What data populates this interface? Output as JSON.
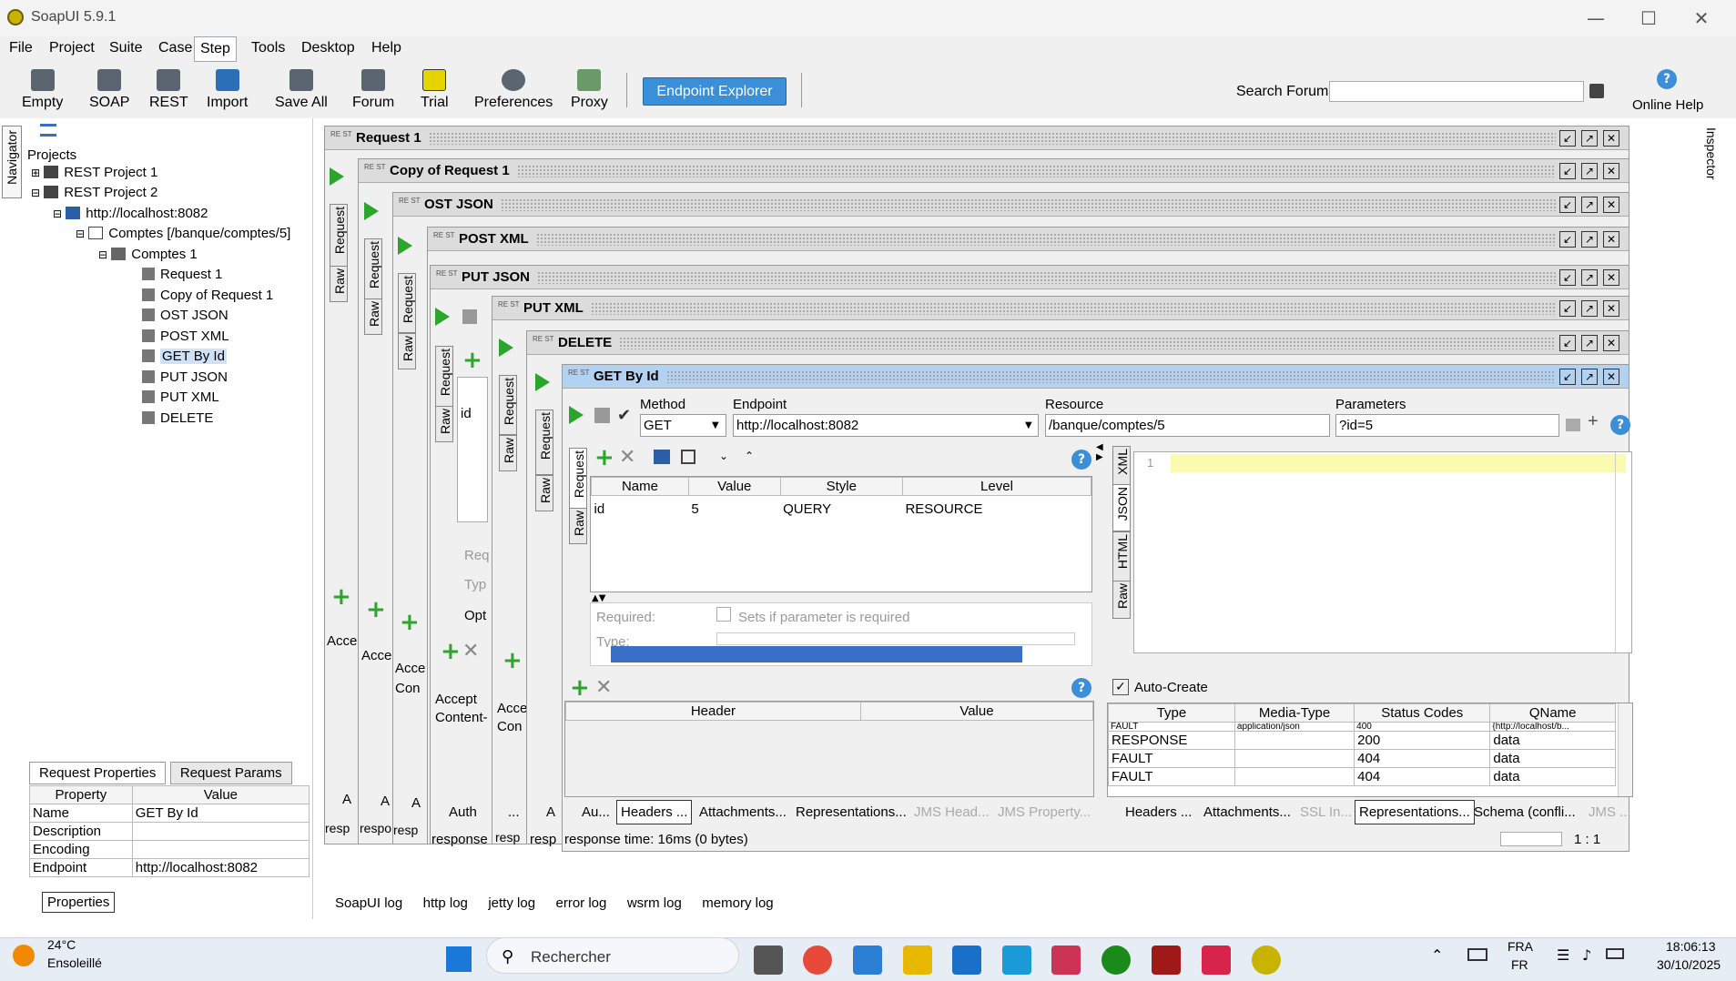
{
  "app": {
    "title": "SoapUI 5.9.1"
  },
  "menu": [
    "File",
    "Project",
    "Suite",
    "Case",
    "Step",
    "Tools",
    "Desktop",
    "Help"
  ],
  "toolbar": {
    "items": [
      "Empty",
      "SOAP",
      "REST",
      "Import",
      "Save All",
      "Forum",
      "Trial",
      "Preferences",
      "Proxy"
    ],
    "endpoint_explorer": "Endpoint Explorer",
    "search_label": "Search Forum",
    "online_help": "Online Help"
  },
  "navigator": {
    "tab": "Navigator",
    "root": "Projects",
    "tree": {
      "p1": "REST Project 1",
      "p2": "REST Project 2",
      "service": "http://localhost:8082",
      "resource": "Comptes [/banque/comptes/5]",
      "method": "Comptes 1",
      "requests": [
        "Request 1",
        "Copy of Request 1",
        "OST JSON",
        "POST XML",
        "GET By Id",
        "PUT JSON",
        "PUT XML",
        "DELETE"
      ]
    }
  },
  "props": {
    "tabs": [
      "Request Properties",
      "Request Params"
    ],
    "headers": [
      "Property",
      "Value"
    ],
    "rows": [
      [
        "Name",
        "GET By Id"
      ],
      [
        "Description",
        ""
      ],
      [
        "Encoding",
        ""
      ],
      [
        "Endpoint",
        "http://localhost:8082"
      ]
    ],
    "button": "Properties"
  },
  "inspector": "Inspector",
  "windows": [
    "Request 1",
    "Copy of Request 1",
    "OST JSON",
    "POST XML",
    "PUT JSON",
    "PUT XML",
    "DELETE",
    "GET By Id"
  ],
  "bg": {
    "request": "Request",
    "raw": "Raw",
    "acc": "Acce",
    "accept": "Accept",
    "content": "Content-",
    "con": "Con",
    "auth": "Auth",
    "response": "response",
    "a": "A",
    "dots": "...",
    "id": "id",
    "req": "Req",
    "typ": "Typ",
    "opt": "Opt",
    "respo": "respo",
    "resp": "resp"
  },
  "main": {
    "method_label": "Method",
    "method": "GET",
    "endpoint_label": "Endpoint",
    "endpoint": "http://localhost:8082",
    "resource_label": "Resource",
    "resource": "/banque/comptes/5",
    "params_label": "Parameters",
    "params": "?id=5",
    "param_table": {
      "headers": [
        "Name",
        "Value",
        "Style",
        "Level"
      ],
      "row": [
        "id",
        "5",
        "QUERY",
        "RESOURCE"
      ]
    },
    "required_label": "Required:",
    "required_hint": "Sets if parameter is required",
    "type_label": "Type:",
    "header_table": [
      "Header",
      "Value"
    ],
    "req_vtabs": [
      "Request",
      "Raw"
    ],
    "bottom_tabs": [
      "Au...",
      "Headers ...",
      "Attachments...",
      "Representations...",
      "JMS Head...",
      "JMS Property..."
    ],
    "response_time": "response time: 16ms (0 bytes)",
    "resp_vtabs": [
      "XML",
      "JSON",
      "HTML",
      "Raw"
    ],
    "line_no": "1",
    "auto_create": "Auto-Create",
    "rep_table": {
      "headers": [
        "Type",
        "Media-Type",
        "Status Codes",
        "QName"
      ],
      "partial": [
        "FAULT",
        "application/json",
        "400",
        "{http://localhost/b..."
      ],
      "rows": [
        [
          "RESPONSE",
          "",
          "200",
          "data"
        ],
        [
          "FAULT",
          "",
          "404",
          "data"
        ],
        [
          "FAULT",
          "",
          "404",
          "data"
        ]
      ]
    },
    "resp_bottom_tabs": [
      "Headers ...",
      "Attachments...",
      "SSL In...",
      "Representations...",
      "Schema (confli...",
      "JMS ..."
    ],
    "cursor_pos": "1 : 1"
  },
  "logs": [
    "SoapUI log",
    "http log",
    "jetty log",
    "error log",
    "wsrm log",
    "memory log"
  ],
  "taskbar": {
    "temp": "24°C",
    "weather": "Ensoleillé",
    "search": "Rechercher",
    "lang1": "FRA",
    "lang2": "FR",
    "time": "18:06:13",
    "date": "30/10/2025"
  },
  "colors": {
    "accent": "#3a8fd8",
    "play": "#2ca52c",
    "selected_title": "#b3d2f2"
  }
}
